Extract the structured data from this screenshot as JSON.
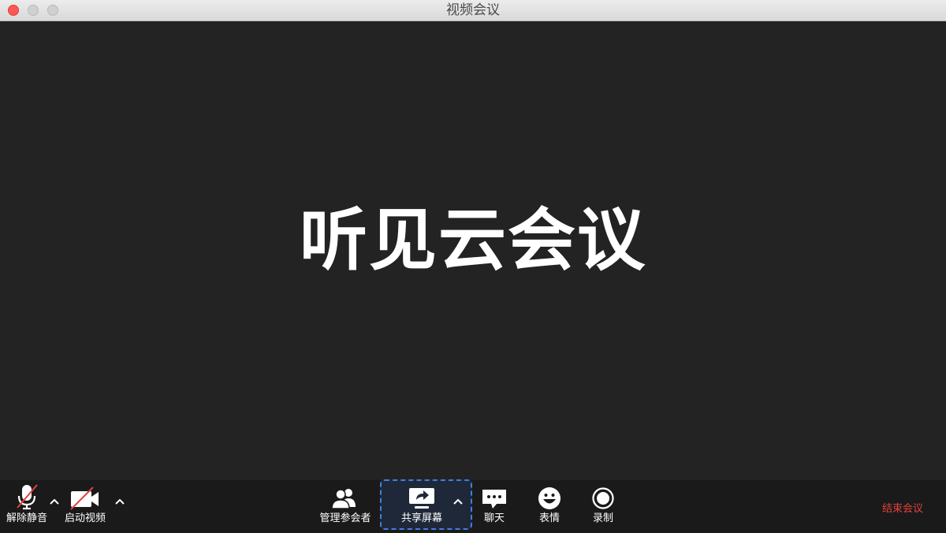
{
  "window": {
    "title": "视频会议"
  },
  "stage": {
    "brand_text": "听见云会议"
  },
  "toolbar": {
    "unmute_label": "解除静音",
    "start_video_label": "启动视频",
    "participants_label": "管理参会者",
    "share_screen_label": "共享屏幕",
    "chat_label": "聊天",
    "reactions_label": "表情",
    "record_label": "录制",
    "end_meeting_label": "结束会议"
  },
  "colors": {
    "stage_background": "#232323",
    "toolbar_background": "#1a1a1a",
    "end_meeting_text": "#e2423b",
    "share_highlight": "#3f7fe0"
  },
  "icons": {
    "unmute": "microphone-muted-icon",
    "video": "camera-off-icon",
    "participants": "people-icon",
    "share": "share-screen-icon",
    "chat": "chat-bubble-icon",
    "reactions": "smiley-icon",
    "record": "record-icon",
    "caret": "chevron-up-icon"
  }
}
